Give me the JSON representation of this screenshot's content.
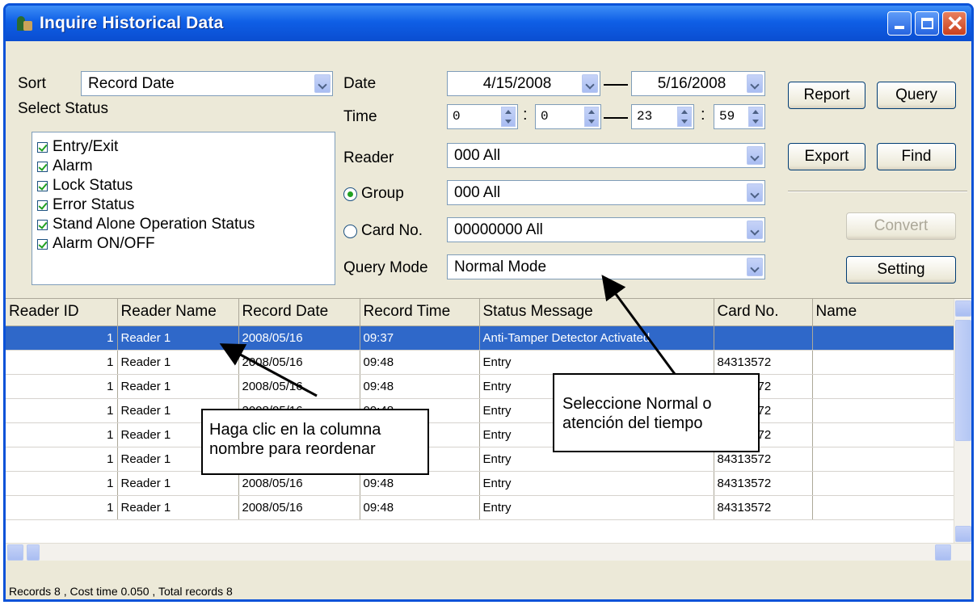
{
  "window": {
    "title": "Inquire Historical Data"
  },
  "filters": {
    "sort_label": "Sort",
    "sort_value": "Record Date",
    "select_status_label": "Select Status",
    "statuses": [
      "Entry/Exit",
      "Alarm",
      "Lock Status",
      "Error Status",
      "Stand Alone Operation Status",
      "Alarm ON/OFF"
    ],
    "date_label": "Date",
    "date_from": "4/15/2008",
    "date_to": "5/16/2008",
    "time_label": "Time",
    "time_from_h": "0",
    "time_from_m": "0",
    "time_to_h": "23",
    "time_to_m": "59",
    "colon": ":",
    "reader_label": "Reader",
    "reader_value": "000 All",
    "group_label": "Group",
    "group_value": "000 All",
    "cardno_label": "Card No.",
    "cardno_value": "00000000 All",
    "querymode_label": "Query Mode",
    "querymode_value": "Normal Mode"
  },
  "buttons": {
    "report": "Report",
    "query": "Query",
    "export": "Export",
    "find": "Find",
    "convert": "Convert",
    "setting": "Setting"
  },
  "table": {
    "columns": [
      "Reader ID",
      "Reader Name",
      "Record Date",
      "Record Time",
      "Status Message",
      "Card No.",
      "Name"
    ],
    "rows": [
      [
        "1",
        "Reader 1",
        "2008/05/16",
        "09:37",
        "Anti-Tamper Detector Activated",
        "",
        ""
      ],
      [
        "1",
        "Reader 1",
        "2008/05/16",
        "09:48",
        "Entry",
        "84313572",
        ""
      ],
      [
        "1",
        "Reader 1",
        "2008/05/16",
        "09:48",
        "Entry",
        "84313572",
        ""
      ],
      [
        "1",
        "Reader 1",
        "2008/05/16",
        "09:48",
        "Entry",
        "84313572",
        ""
      ],
      [
        "1",
        "Reader 1",
        "2008/05/16",
        "09:48",
        "Entry",
        "84313572",
        ""
      ],
      [
        "1",
        "Reader 1",
        "2008/05/16",
        "09:48",
        "Entry",
        "84313572",
        ""
      ],
      [
        "1",
        "Reader 1",
        "2008/05/16",
        "09:48",
        "Entry",
        "84313572",
        ""
      ],
      [
        "1",
        "Reader 1",
        "2008/05/16",
        "09:48",
        "Entry",
        "84313572",
        ""
      ]
    ]
  },
  "statusbar": {
    "text": "Records 8 , Cost time 0.050 , Total records 8"
  },
  "callouts": {
    "left_line1": "Haga clic en la columna",
    "left_line2": "nombre para reordenar",
    "right_line1": "Seleccione Normal o",
    "right_line2": "atención del tiempo"
  },
  "colors": {
    "titlebar": "#0a4dd0",
    "selected_row": "#2f68c9",
    "background": "#ece9d8"
  }
}
